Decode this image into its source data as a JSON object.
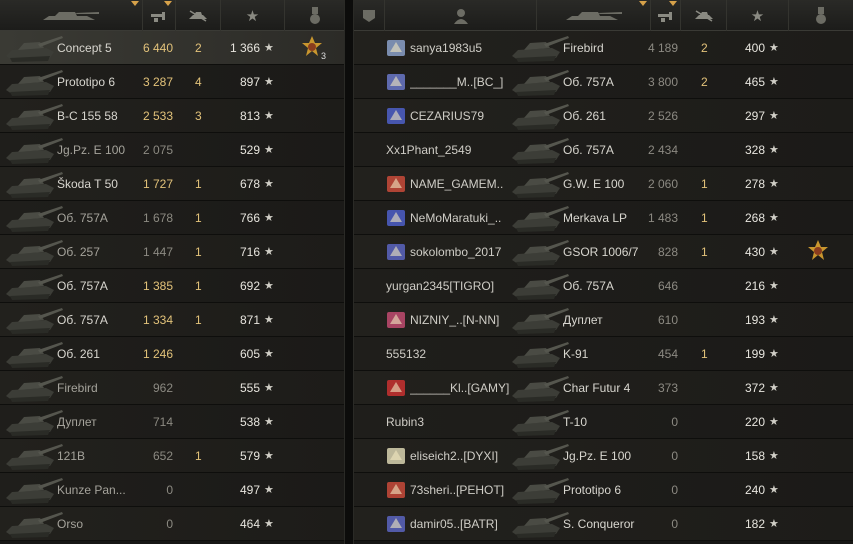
{
  "left_team": {
    "header": {
      "columns": [
        {
          "name": "tank-icon",
          "label": ""
        },
        {
          "name": "damage-icon",
          "label": ""
        },
        {
          "name": "kills-icon",
          "label": ""
        },
        {
          "name": "xp-star-icon",
          "label": "★"
        },
        {
          "name": "medal-icon",
          "label": ""
        }
      ]
    },
    "rows": [
      {
        "tank": "Concept 5",
        "damage": "6 440",
        "kills": "2",
        "xp": "1 366",
        "star": "★",
        "award": true,
        "award_count": "3",
        "highlight": true,
        "dim": false
      },
      {
        "tank": "Prototipo 6",
        "damage": "3 287",
        "kills": "4",
        "xp": "897",
        "star": "★",
        "dim": false
      },
      {
        "tank": "B-C 155 58",
        "damage": "2 533",
        "kills": "3",
        "xp": "813",
        "star": "★",
        "dim": false
      },
      {
        "tank": "Jg.Pz. E 100",
        "damage": "2 075",
        "kills": "",
        "xp": "529",
        "star": "★",
        "dim": true
      },
      {
        "tank": "Škoda T 50",
        "damage": "1 727",
        "kills": "1",
        "xp": "678",
        "star": "★",
        "dim": false
      },
      {
        "tank": "Об. 757А",
        "damage": "1 678",
        "kills": "1",
        "xp": "766",
        "star": "★",
        "dim": true
      },
      {
        "tank": "Об. 257",
        "damage": "1 447",
        "kills": "1",
        "xp": "716",
        "star": "★",
        "dim": true
      },
      {
        "tank": "Об. 757А",
        "damage": "1 385",
        "kills": "1",
        "xp": "692",
        "star": "★",
        "dim": false
      },
      {
        "tank": "Об. 757А",
        "damage": "1 334",
        "kills": "1",
        "xp": "871",
        "star": "★",
        "dim": false
      },
      {
        "tank": "Об. 261",
        "damage": "1 246",
        "kills": "",
        "xp": "605",
        "star": "★",
        "dim": false
      },
      {
        "tank": "Firebird",
        "damage": "962",
        "kills": "",
        "xp": "555",
        "star": "★",
        "dim": true
      },
      {
        "tank": "Дуплет",
        "damage": "714",
        "kills": "",
        "xp": "538",
        "star": "★",
        "dim": true
      },
      {
        "tank": "121B",
        "damage": "652",
        "kills": "1",
        "xp": "579",
        "star": "★",
        "dim": true
      },
      {
        "tank": "Kunze Pan...",
        "damage": "0",
        "kills": "",
        "xp": "497",
        "star": "★",
        "dim": true
      },
      {
        "tank": "Orso",
        "damage": "0",
        "kills": "",
        "xp": "464",
        "star": "★",
        "dim": true
      }
    ]
  },
  "right_team": {
    "header": {
      "columns": [
        {
          "name": "clan-icon",
          "label": ""
        },
        {
          "name": "player-icon",
          "label": ""
        },
        {
          "name": "tank-icon",
          "label": ""
        },
        {
          "name": "damage-icon",
          "label": ""
        },
        {
          "name": "kills-icon",
          "label": ""
        },
        {
          "name": "xp-star-icon",
          "label": "★"
        },
        {
          "name": "medal-icon",
          "label": ""
        }
      ]
    },
    "rows": [
      {
        "player": "sanya1983u5",
        "emblem": "wolf",
        "tank": "Firebird",
        "damage": "4 189",
        "kills": "2",
        "xp": "400",
        "star": "★"
      },
      {
        "player": "_______M..[BC_]",
        "emblem": "wing",
        "tank": "Об. 757А",
        "damage": "3 800",
        "kills": "2",
        "xp": "465",
        "star": "★"
      },
      {
        "player": "CEZARIUS79",
        "emblem": "shield",
        "tank": "Об. 261",
        "damage": "2 526",
        "kills": "",
        "xp": "297",
        "star": "★"
      },
      {
        "player": "Xx1Phant_2549",
        "emblem": "",
        "tank": "Об. 757А",
        "damage": "2 434",
        "kills": "",
        "xp": "328",
        "star": "★"
      },
      {
        "player": "NAME_GAMEM..",
        "emblem": "rose",
        "tank": "G.W. E 100",
        "damage": "2 060",
        "kills": "1",
        "xp": "278",
        "star": "★"
      },
      {
        "player": "NeMoMaratuki_..",
        "emblem": "shield",
        "tank": "Merkava LP",
        "damage": "1 483",
        "kills": "1",
        "xp": "268",
        "star": "★"
      },
      {
        "player": "sokolombo_2017",
        "emblem": "bird",
        "tank": "GSOR 1006/7",
        "damage": "828",
        "kills": "1",
        "xp": "430",
        "star": "★",
        "award": true
      },
      {
        "player": "yurgan2345[TIGRO]",
        "emblem": "",
        "tank": "Об. 757А",
        "damage": "646",
        "kills": "",
        "xp": "216",
        "star": "★"
      },
      {
        "player": "NIZNIY_..[N-NN]",
        "emblem": "round",
        "tank": "Дуплет",
        "damage": "610",
        "kills": "",
        "xp": "193",
        "star": "★"
      },
      {
        "player": "555132",
        "emblem": "",
        "tank": "K-91",
        "damage": "454",
        "kills": "1",
        "xp": "199",
        "star": "★"
      },
      {
        "player": "______Kl..[GAMY]",
        "emblem": "star",
        "tank": "Char Futur 4",
        "damage": "373",
        "kills": "",
        "xp": "372",
        "star": "★"
      },
      {
        "player": "Rubin3",
        "emblem": "",
        "tank": "T-10",
        "damage": "0",
        "kills": "",
        "xp": "220",
        "star": "★"
      },
      {
        "player": "eliseich2..[DYXI]",
        "emblem": "snow",
        "tank": "Jg.Pz. E 100",
        "damage": "0",
        "kills": "",
        "xp": "158",
        "star": "★"
      },
      {
        "player": "73sheri..[PEHOT]",
        "emblem": "fire",
        "tank": "Prototipo 6",
        "damage": "0",
        "kills": "",
        "xp": "240",
        "star": "★"
      },
      {
        "player": "damir05..[BATR]",
        "emblem": "bird",
        "tank": "S. Conqueror",
        "damage": "0",
        "kills": "",
        "xp": "182",
        "star": "★"
      }
    ]
  },
  "colors": {
    "damage_highlight": "#e2c27a",
    "damage_dim": "#8c8a82",
    "sort_arrow": "#d7a24a",
    "row_highlight": "#3a3a34"
  }
}
